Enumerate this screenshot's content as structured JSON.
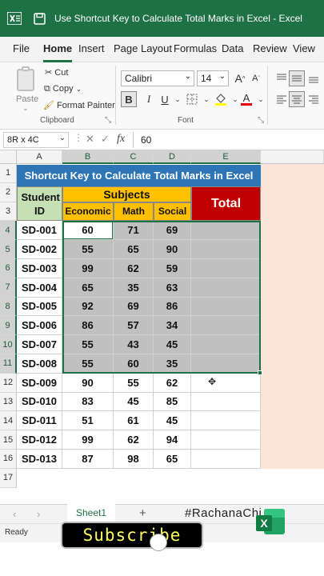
{
  "window": {
    "title": "Use Shortcut Key to Calculate Total Marks in Excel  -  Excel",
    "accent": "#1e7145"
  },
  "menu": [
    "File",
    "Home",
    "Insert",
    "Page Layout",
    "Formulas",
    "Data",
    "Review",
    "View"
  ],
  "menu_active": "Home",
  "ribbon": {
    "paste": "Paste",
    "cut": "Cut",
    "copy": "Copy",
    "format_painter": "Format Painter",
    "clipboard_group": "Clipboard",
    "font_name": "Calibri",
    "font_size": "14",
    "font_group": "Font",
    "bold": "B",
    "italic": "I",
    "underline": "U",
    "grow": "A",
    "shrink": "A",
    "font_color_letter": "A"
  },
  "formula_bar": {
    "name_box": "8R x 4C",
    "fx": "fx",
    "value": "60"
  },
  "columns": [
    "A",
    "B",
    "C",
    "D",
    "E"
  ],
  "selected_columns": [
    "B",
    "C",
    "D",
    "E"
  ],
  "rows": [
    1,
    2,
    3,
    4,
    5,
    6,
    7,
    8,
    9,
    10,
    11,
    12,
    13,
    14,
    15,
    16,
    17
  ],
  "selected_rows": [
    4,
    5,
    6,
    7,
    8,
    9,
    10,
    11
  ],
  "sheet": {
    "title": "Shortcut Key to Calculate Total Marks in Excel",
    "student_id_header": "Student ID",
    "subjects_header": "Subjects",
    "total_header": "Total",
    "subject_names": [
      "Economic",
      "Math",
      "Social"
    ],
    "records": [
      [
        "SD-001",
        60,
        71,
        69
      ],
      [
        "SD-002",
        55,
        65,
        90
      ],
      [
        "SD-003",
        99,
        62,
        59
      ],
      [
        "SD-004",
        65,
        35,
        63
      ],
      [
        "SD-005",
        92,
        69,
        86
      ],
      [
        "SD-006",
        86,
        57,
        34
      ],
      [
        "SD-007",
        55,
        43,
        45
      ],
      [
        "SD-008",
        55,
        60,
        35
      ],
      [
        "SD-009",
        90,
        55,
        62
      ],
      [
        "SD-010",
        83,
        45,
        85
      ],
      [
        "SD-011",
        51,
        61,
        45
      ],
      [
        "SD-012",
        99,
        62,
        94
      ],
      [
        "SD-013",
        87,
        98,
        65
      ]
    ],
    "colors": {
      "title_bg": "#2e75b6",
      "student_bg": "#c6e0b4",
      "subject_bg": "#ffc000",
      "total_bg": "#c00000",
      "selected_bg": "#c0c0c0",
      "page_bg": "#fce4d6"
    }
  },
  "tabs": {
    "sheet": "Sheet1",
    "add": "+",
    "hashtag": "#RachanaChi"
  },
  "status": {
    "ready": "Ready"
  },
  "overlay": {
    "subscribe": "Subscribe"
  }
}
